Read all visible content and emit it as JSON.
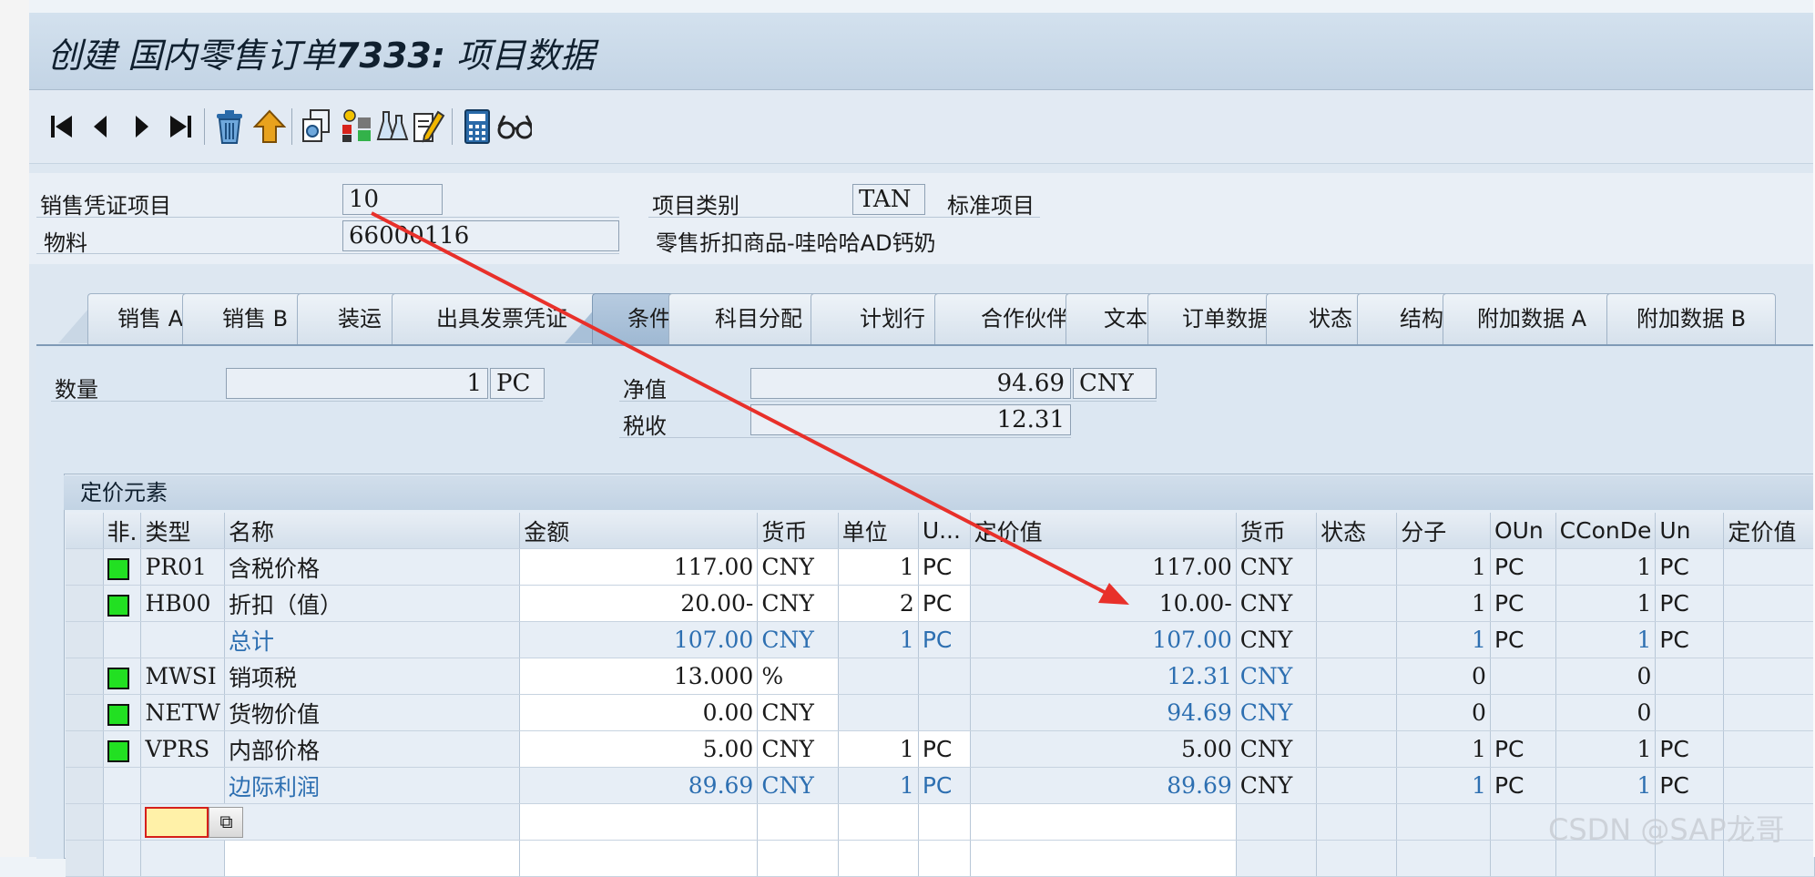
{
  "title": {
    "prefix": "创建 国内零售订单",
    "number": "7333:",
    "suffix": " 项目数据"
  },
  "toolbar": {
    "buttons": [
      "first-item-icon",
      "previous-item-icon",
      "next-item-icon",
      "last-item-icon",
      "delete-icon",
      "up-arrow-icon",
      "display-doc-flow-icon",
      "status-overview-icon",
      "configuration-icon",
      "edit-notes-icon",
      "calculator-icon",
      "glasses-icon"
    ]
  },
  "header": {
    "sales_item_label": "销售凭证项目",
    "sales_item_value": "10",
    "item_category_label": "项目类别",
    "item_category_value": "TAN",
    "item_category_text": "标准项目",
    "material_label": "物料",
    "material_value": "66000116",
    "material_desc": "零售折扣商品-哇哈哈AD钙奶"
  },
  "tabs": [
    "销售 A",
    "销售 B",
    "装运",
    "出具发票凭证",
    "条件",
    "科目分配",
    "计划行",
    "合作伙伴",
    "文本",
    "订单数据",
    "状态",
    "结构",
    "附加数据 A",
    "附加数据 B"
  ],
  "active_tab": "条件",
  "conditions": {
    "quantity_label": "数量",
    "quantity_value": "1",
    "quantity_unit": "PC",
    "net_label": "净值",
    "net_value": "94.69",
    "net_currency": "CNY",
    "tax_label": "税收",
    "tax_value": "12.31"
  },
  "pricing": {
    "title": "定价元素",
    "columns": [
      "非.",
      "类型",
      "名称",
      "金额",
      "货币",
      "单位",
      "U...",
      "定价值",
      "货币",
      "状态",
      "分子",
      "OUn",
      "CConDe",
      "Un",
      "定价值"
    ],
    "rows": [
      {
        "sq": true,
        "type": "PR01",
        "name": "含税价格",
        "amount": "117.00",
        "curr": "CNY",
        "per": "1",
        "uom": "PC",
        "value": "117.00",
        "vcurr": "CNY",
        "num": "1",
        "oun": "PC",
        "ccon": "1",
        "un": "PC",
        "sub": false
      },
      {
        "sq": true,
        "type": "HB00",
        "name": "折扣（值）",
        "amount": "20.00-",
        "curr": "CNY",
        "per": "2",
        "uom": "PC",
        "value": "10.00-",
        "vcurr": "CNY",
        "num": "1",
        "oun": "PC",
        "ccon": "1",
        "un": "PC",
        "sub": false
      },
      {
        "sq": false,
        "type": "",
        "name": "总计",
        "amount": "107.00",
        "curr": "CNY",
        "per": "1",
        "uom": "PC",
        "value": "107.00",
        "vcurr": "CNY",
        "num": "1",
        "oun": "PC",
        "ccon": "1",
        "un": "PC",
        "sub": true
      },
      {
        "sq": true,
        "type": "MWSI",
        "name": "销项税",
        "amount": "13.000",
        "curr": "%",
        "per": "",
        "uom": "",
        "value": "12.31",
        "vcurr": "CNY",
        "num": "0",
        "oun": "",
        "ccon": "0",
        "un": "",
        "sub": false,
        "value_blue": true
      },
      {
        "sq": true,
        "type": "NETW",
        "name": "货物价值",
        "amount": "0.00",
        "curr": "CNY",
        "per": "",
        "uom": "",
        "value": "94.69",
        "vcurr": "CNY",
        "num": "0",
        "oun": "",
        "ccon": "0",
        "un": "",
        "sub": false,
        "value_blue": true
      },
      {
        "sq": true,
        "type": "VPRS",
        "name": "内部价格",
        "amount": "5.00",
        "curr": "CNY",
        "per": "1",
        "uom": "PC",
        "value": "5.00",
        "vcurr": "CNY",
        "num": "1",
        "oun": "PC",
        "ccon": "1",
        "un": "PC",
        "sub": false
      },
      {
        "sq": false,
        "type": "",
        "name": "边际利润",
        "amount": "89.69",
        "curr": "CNY",
        "per": "1",
        "uom": "PC",
        "value": "89.69",
        "vcurr": "CNY",
        "num": "1",
        "oun": "PC",
        "ccon": "1",
        "un": "PC",
        "sub": true
      }
    ]
  },
  "watermark": "CSDN @SAP龙哥",
  "colors": {
    "active_tab": "#9fb9d3",
    "condition_square": "#22e022",
    "subtotal_text": "#2d6fb1",
    "annotation_arrow": "#e8302a"
  }
}
